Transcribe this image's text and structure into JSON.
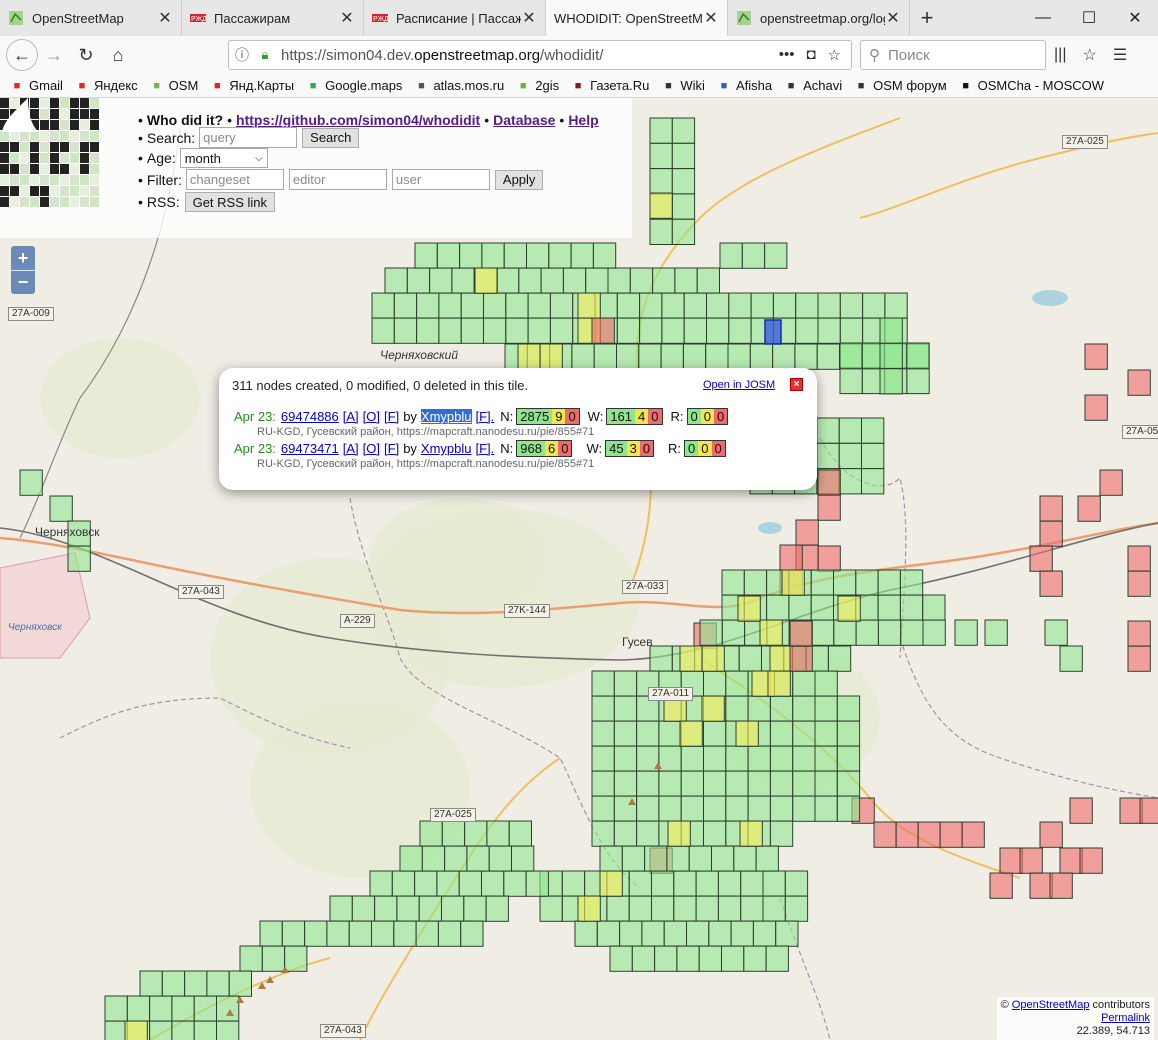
{
  "browser": {
    "tabs": [
      {
        "title": "OpenStreetMap",
        "icon": "osm-map-icon",
        "active": false
      },
      {
        "title": "Пассажирам",
        "icon": "rzd-icon",
        "active": false
      },
      {
        "title": "Расписание | Пассажи",
        "icon": "rzd-icon",
        "active": false
      },
      {
        "title": "WHODIDIT: OpenStreetMa",
        "icon": "none",
        "active": true
      },
      {
        "title": "openstreetmap.org/log",
        "icon": "osm-map-icon",
        "active": false
      }
    ],
    "url_prefix": "https://simon04.dev.",
    "url_host": "openstreetmap.org",
    "url_path": "/whodidit/",
    "search_placeholder": "Поиск",
    "bookmarks": [
      {
        "label": "Gmail",
        "icon": "gmail-icon",
        "color": "#d93025"
      },
      {
        "label": "Яндекс",
        "icon": "yandex-icon",
        "color": "#e22"
      },
      {
        "label": "OSM",
        "icon": "osm-icon",
        "color": "#7ab648"
      },
      {
        "label": "Янд.Карты",
        "icon": "map-pin-icon",
        "color": "#e22"
      },
      {
        "label": "Google.maps",
        "icon": "google-maps-icon",
        "color": "#34a853"
      },
      {
        "label": "atlas.mos.ru",
        "icon": "atlas-icon",
        "color": "#555"
      },
      {
        "label": "2gis",
        "icon": "2gis-icon",
        "color": "#6db33f"
      },
      {
        "label": "Газета.Ru",
        "icon": "gazeta-icon",
        "color": "#8b1a1a"
      },
      {
        "label": "Wiki",
        "icon": "wikipedia-icon",
        "color": "#333"
      },
      {
        "label": "Afisha",
        "icon": "afisha-icon",
        "color": "#2d5fc4"
      },
      {
        "label": "Achavi",
        "icon": "globe-icon",
        "color": "#333"
      },
      {
        "label": "OSM форум",
        "icon": "globe-icon",
        "color": "#333"
      },
      {
        "label": "OSMCha - MOSCOW",
        "icon": "osmcha-icon",
        "color": "#111"
      }
    ]
  },
  "panel": {
    "title": "Who did it?",
    "github_link": "https://github.com/simon04/whodidit",
    "database_link": "Database",
    "help_link": "Help",
    "search_label": "Search:",
    "search_placeholder": "query",
    "search_button": "Search",
    "age_label": "Age:",
    "age_value": "month",
    "filter_label": "Filter:",
    "filter_changeset_placeholder": "changeset",
    "filter_editor_placeholder": "editor",
    "filter_user_placeholder": "user",
    "apply_button": "Apply",
    "rss_label": "RSS:",
    "rss_button": "Get RSS link",
    "bullet": "•"
  },
  "map": {
    "zoom_in": "+",
    "zoom_out": "−",
    "road_labels": [
      "27A-025",
      "27A-009",
      "27A-05",
      "27A-043",
      "27A-033",
      "A-229",
      "27K-144",
      "27A-011",
      "27A-025",
      "27A-043"
    ],
    "place_labels": [
      "Черняховский",
      "Черняховск",
      "Черняховск",
      "Гусев"
    ],
    "attribution_prefix": "©",
    "attribution_link": "OpenStreetMap",
    "attribution_suffix": "contributors",
    "permalink": "Permalink",
    "coords": "22.389, 54.713",
    "tile_colors": {
      "green": "#8fe88f",
      "yellow": "#f6ec5a",
      "red": "#f26a6a",
      "selected": "#3b5de0"
    }
  },
  "popup": {
    "summary": "311 nodes created, 0 modified, 0 deleted in this tile.",
    "open_josm": "Open in JOSM",
    "close": "×",
    "changesets": [
      {
        "date": "Apr 23:",
        "id": "69474886",
        "a": "[A]",
        "o": "[O]",
        "f": "[F]",
        "by": "by",
        "user": "Xmypblu",
        "user_f": "[F].",
        "n_label": "N:",
        "n": [
          "2875",
          "9",
          "0"
        ],
        "w_label": "W:",
        "w": [
          "161",
          "4",
          "0"
        ],
        "r_label": "R:",
        "r": [
          "0",
          "0",
          "0"
        ],
        "desc": "RU-KGD, Гусевский район, https://mapcraft.nanodesu.ru/pie/855#71"
      },
      {
        "date": "Apr 23:",
        "id": "69473471",
        "a": "[A]",
        "o": "[O]",
        "f": "[F]",
        "by": "by",
        "user": "Xmypblu",
        "user_f": "[F].",
        "n_label": "N:",
        "n": [
          "968",
          "6",
          "0"
        ],
        "w_label": "W:",
        "w": [
          "45",
          "3",
          "0"
        ],
        "r_label": "R:",
        "r": [
          "0",
          "0",
          "0"
        ],
        "desc": "RU-KGD, Гусевский район, https://mapcraft.nanodesu.ru/pie/855#71"
      }
    ]
  }
}
